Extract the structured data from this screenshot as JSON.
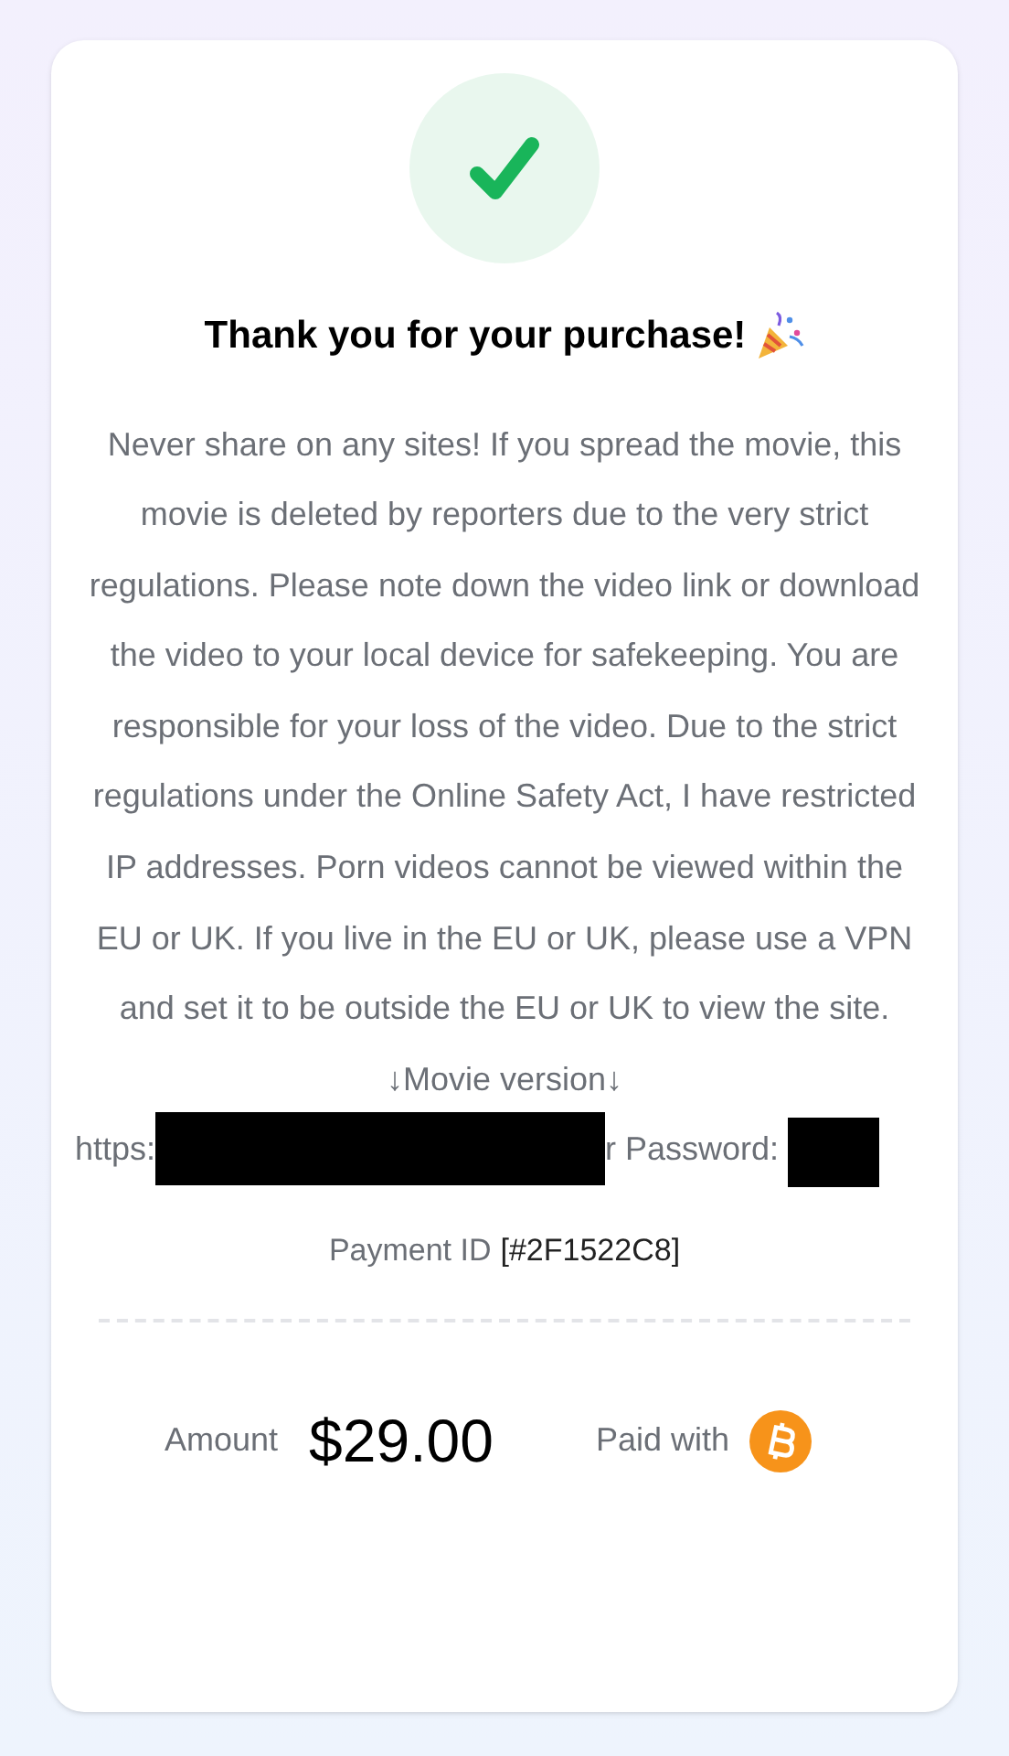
{
  "title": "Thank you for your purchase!",
  "message": "Never share on any sites! If you spread the movie, this movie is deleted by reporters due to the very strict regulations. Please note down the video link or download the video to your local device for safekeeping. You are responsible for your loss of the video. Due to the strict regulations under the Online Safety Act, I have restricted IP addresses. Porn videos cannot be viewed within the EU or UK. If you live in the EU or UK, please use a VPN and set it to be outside the EU or UK to view the site. ↓Movie version↓",
  "link_line": {
    "prefix": "https:",
    "middle": "r Password:"
  },
  "payment_id": {
    "label": "Payment ID",
    "value": "[#2F1522C8]"
  },
  "amount": {
    "label": "Amount",
    "value": "$29.00"
  },
  "paid_with": {
    "label": "Paid with"
  }
}
